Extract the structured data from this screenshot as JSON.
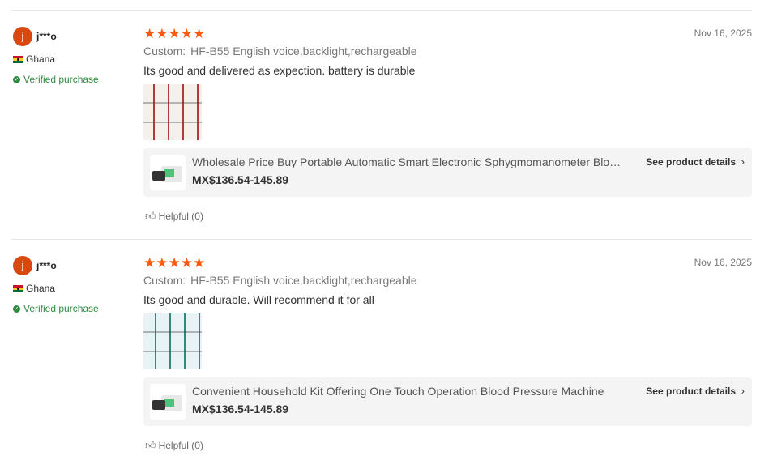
{
  "reviews": [
    {
      "user": {
        "initial": "j",
        "name": "j***o",
        "country": "Ghana",
        "verified": "Verified purchase"
      },
      "stars": "★★★★★",
      "rating": 5,
      "date": "Nov 16, 2025",
      "custom_label": "Custom:",
      "custom_value": "HF-B55 English voice,backlight,rechargeable",
      "text": "Its good and delivered as expection. battery is durable",
      "product": {
        "title": "Wholesale Price Buy Portable Automatic Smart Electronic Sphygmomanometer Blood Pressure Monitor",
        "price": "MX$136.54-145.89",
        "details_label": "See product details"
      },
      "helpful": "Helpful (0)"
    },
    {
      "user": {
        "initial": "j",
        "name": "j***o",
        "country": "Ghana",
        "verified": "Verified purchase"
      },
      "stars": "★★★★★",
      "rating": 5,
      "date": "Nov 16, 2025",
      "custom_label": "Custom:",
      "custom_value": "HF-B55 English voice,backlight,rechargeable",
      "text": "Its good and durable. Will recommend it for all",
      "product": {
        "title": "Convenient Household Kit Offering One Touch Operation Blood Pressure Machine",
        "price": "MX$136.54-145.89",
        "details_label": "See product details"
      },
      "helpful": "Helpful (0)"
    }
  ],
  "colors": {
    "avatar": "#d9480f",
    "stars": "#fd5b0b",
    "verified": "#2e8b3e",
    "product_bg": "#f4f4f4"
  },
  "icons": {
    "verified": "verified-check-icon",
    "chevron": "chevron-right-icon",
    "helpful": "thumbs-up-icon"
  }
}
